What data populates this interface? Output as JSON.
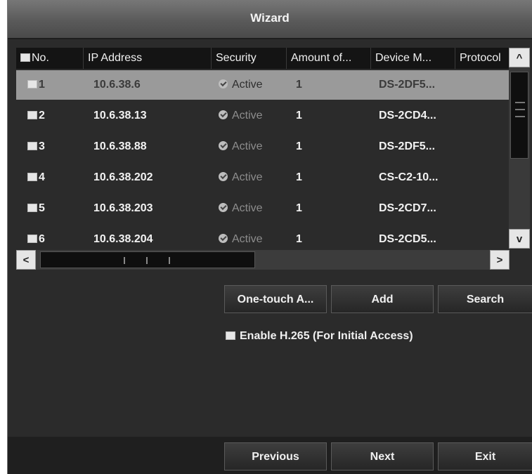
{
  "window": {
    "title": "Wizard"
  },
  "table": {
    "columns": [
      "No.",
      "IP Address",
      "Security",
      "Amount of...",
      "Device M...",
      "Protocol"
    ],
    "rows": [
      {
        "no": "1",
        "ip": "10.6.38.6",
        "security": "Active",
        "amount": "1",
        "device": "DS-2DF5...",
        "selected": true
      },
      {
        "no": "2",
        "ip": "10.6.38.13",
        "security": "Active",
        "amount": "1",
        "device": "DS-2CD4...",
        "selected": false
      },
      {
        "no": "3",
        "ip": "10.6.38.88",
        "security": "Active",
        "amount": "1",
        "device": "DS-2DF5...",
        "selected": false
      },
      {
        "no": "4",
        "ip": "10.6.38.202",
        "security": "Active",
        "amount": "1",
        "device": "CS-C2-10...",
        "selected": false
      },
      {
        "no": "5",
        "ip": "10.6.38.203",
        "security": "Active",
        "amount": "1",
        "device": "DS-2CD7...",
        "selected": false
      },
      {
        "no": "6",
        "ip": "10.6.38.204",
        "security": "Active",
        "amount": "1",
        "device": "DS-2CD5...",
        "selected": false
      }
    ]
  },
  "scroll": {
    "up": "^",
    "down": "v",
    "left": "<",
    "right": ">"
  },
  "actions": {
    "one_touch": "One-touch A...",
    "add": "Add",
    "search": "Search"
  },
  "options": {
    "h265_label": "Enable H.265 (For Initial Access)"
  },
  "nav": {
    "previous": "Previous",
    "next": "Next",
    "exit": "Exit"
  }
}
